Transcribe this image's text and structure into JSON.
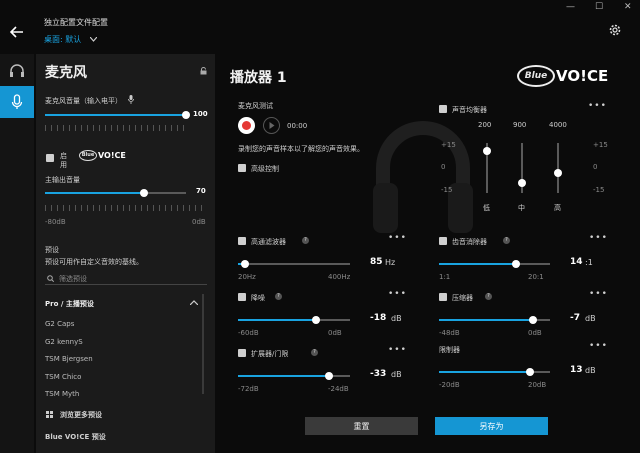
{
  "window": {
    "minimize": "—",
    "maximize": "☐",
    "close": "✕"
  },
  "header": {
    "title": "独立配置文件配置",
    "profile": "桌面: 默认"
  },
  "sidebar": {
    "title": "麦克风",
    "mic_level_label": "麦克风音量（输入电平）",
    "mic_level_value": "100",
    "mic_level_fraction": 1.0,
    "enable_label_1": "启",
    "enable_label_2": "用",
    "blue_voice_logo": "Blue VO!CE",
    "output_label": "主输出音量",
    "output_value": "70",
    "output_fraction": 0.7,
    "output_min": "-80dB",
    "output_max": "0dB",
    "preset_heading": "预设",
    "preset_desc": "预设可用作自定义音效的基线。",
    "filter_placeholder": "筛选预设",
    "group_title": "Pro / 主播预设",
    "presets": [
      "G2 Caps",
      "G2 kennyS",
      "TSM Bjergsen",
      "TSM Chico",
      "TSM Myth"
    ],
    "browse_more": "浏览更多预设",
    "group2_title": "Blue VO!CE 预设"
  },
  "main": {
    "title": "播放器 1",
    "logo": "Blue VO!CE",
    "mic_test_label": "麦克风测试",
    "time": "00:00",
    "record_hint": "录制您的声音样本以了解您的声音效果。",
    "advanced_label": "高级控制",
    "eq": {
      "label": "声音均衡器",
      "bands": [
        "200",
        "900",
        "4000"
      ],
      "scale": [
        "+15",
        "0",
        "-15"
      ],
      "band_labels": [
        "低",
        "中",
        "高"
      ],
      "levels": [
        0.85,
        0.2,
        0.4
      ]
    },
    "highpass": {
      "label": "高通滤波器",
      "value": "85",
      "unit": "Hz",
      "min": "20Hz",
      "max": "400Hz",
      "fraction": 0.06
    },
    "declicker": {
      "label": "齿音消除器",
      "value": "14",
      "unit": ":1",
      "min": "1:1",
      "max": "20:1",
      "fraction": 0.69
    },
    "noise": {
      "label": "降噪",
      "value": "-18",
      "unit": "dB",
      "min": "-60dB",
      "max": "0dB",
      "fraction": 0.7
    },
    "compressor": {
      "label": "压缩器",
      "value": "-7",
      "unit": "dB",
      "min": "-48dB",
      "max": "0dB",
      "fraction": 0.85
    },
    "expander": {
      "label": "扩展器/门限",
      "value": "-33",
      "unit": "dB",
      "min": "-72dB",
      "max": "-24dB",
      "fraction": 0.81
    },
    "limiter": {
      "label": "限制器",
      "value": "13",
      "unit": "dB",
      "min": "-20dB",
      "max": "20dB",
      "fraction": 0.82
    },
    "reset": "重置",
    "save_as": "另存为"
  },
  "colors": {
    "accent": "#19a3e0",
    "record": "#e53935"
  }
}
